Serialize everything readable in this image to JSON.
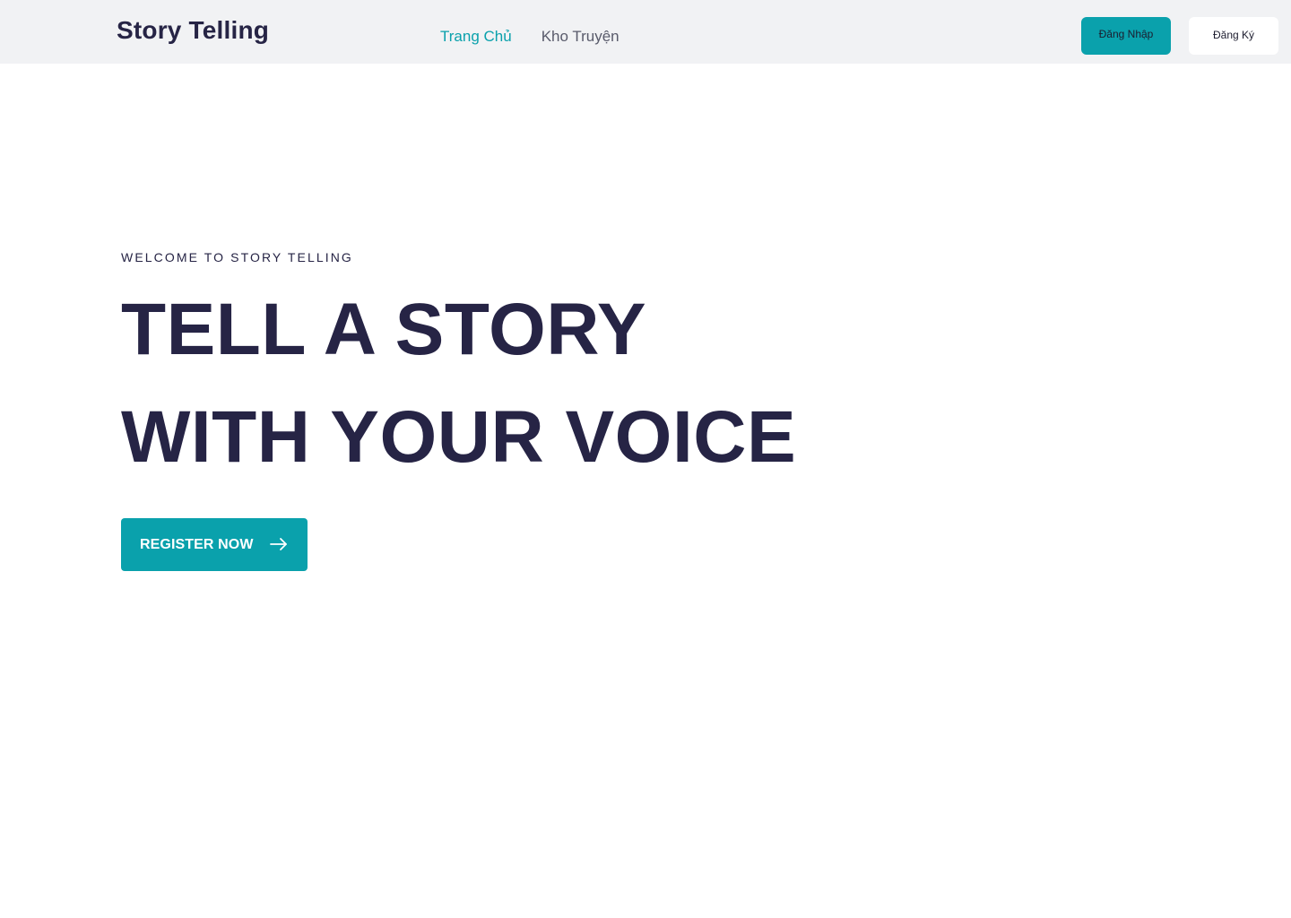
{
  "header": {
    "brand": "Story Telling",
    "nav": [
      {
        "label": "Trang Chủ",
        "active": true
      },
      {
        "label": "Kho Truyện",
        "active": false
      }
    ],
    "login_label": "Đăng Nhập",
    "signup_label": "Đăng Ký"
  },
  "hero": {
    "eyebrow": "WELCOME TO STORY TELLING",
    "headline_line1": "TELL A STORY",
    "headline_line2": "WITH YOUR VOICE",
    "cta_label": "REGISTER NOW",
    "cta_icon": "arrow-right-icon"
  },
  "colors": {
    "accent": "#0aa1ac",
    "text_dark": "#262445",
    "nav_bg": "#f1f2f4"
  }
}
